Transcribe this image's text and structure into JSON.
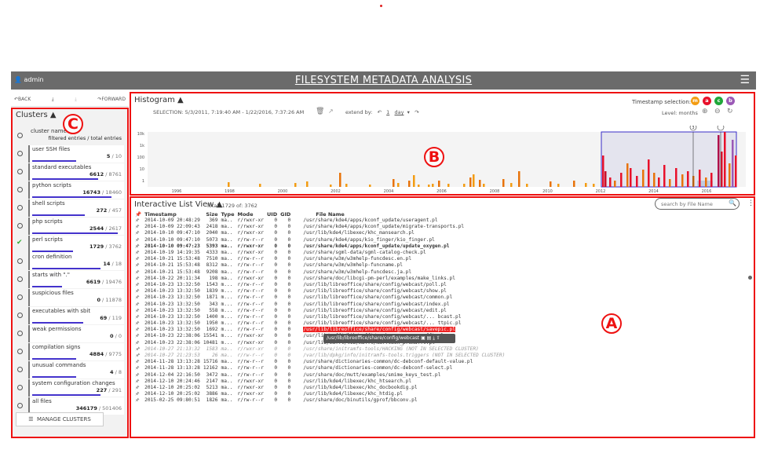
{
  "header": {
    "user": "admin",
    "title": "FILESYSTEM METADATA ANALYSIS",
    "menu_icon": "hamburger-icon"
  },
  "nav": {
    "back": "BACK",
    "forward": "FORWARD"
  },
  "labels": {
    "A": "A",
    "B": "B",
    "C": "C"
  },
  "clusters": {
    "title": "Clusters",
    "header_name": "cluster name",
    "header_sub": "filtered entries / total entries",
    "items": [
      {
        "name": "user SSH files",
        "filtered": "5",
        "total": "10",
        "pct": 0.5
      },
      {
        "name": "standard executables",
        "filtered": "6612",
        "total": "8761",
        "pct": 0.75
      },
      {
        "name": "python scripts",
        "filtered": "16743",
        "total": "18460",
        "pct": 0.9
      },
      {
        "name": "shell scripts",
        "filtered": "272",
        "total": "457",
        "pct": 0.6
      },
      {
        "name": "php scripts",
        "filtered": "2544",
        "total": "2617",
        "pct": 0.97
      },
      {
        "name": "perl scripts",
        "filtered": "1729",
        "total": "3762",
        "pct": 0.46,
        "checked": true
      },
      {
        "name": "cron definition",
        "filtered": "14",
        "total": "18",
        "pct": 0.78
      },
      {
        "name": "starts with \".\"",
        "filtered": "6619",
        "total": "19476",
        "pct": 0.34
      },
      {
        "name": "suspicious files",
        "filtered": "0",
        "total": "11878",
        "pct": 0
      },
      {
        "name": "executables with sbit",
        "filtered": "69",
        "total": "119",
        "pct": 0.58
      },
      {
        "name": "weak permissions",
        "filtered": "0",
        "total": "0",
        "pct": 0
      },
      {
        "name": "compilation signs",
        "filtered": "4884",
        "total": "9775",
        "pct": 0.5
      },
      {
        "name": "unusual commands",
        "filtered": "4",
        "total": "8",
        "pct": 0.5
      },
      {
        "name": "system configuration changes",
        "filtered": "227",
        "total": "291",
        "pct": 0.78
      },
      {
        "name": "all files",
        "filtered": "346179",
        "total": "501406",
        "pct": 0.69
      }
    ],
    "manage": "MANAGE CLUSTERS"
  },
  "histogram": {
    "title": "Histogram",
    "selection": "SELECTION: 5/3/2011, 7:19:40 AM - 1/22/2016, 7:37:26 AM",
    "extend_label": "extend by:",
    "extend_value": "1",
    "extend_unit": "day",
    "ts_label": "Timestamp selection:",
    "ts_buttons": [
      {
        "l": "m",
        "c": "#f39c12"
      },
      {
        "l": "a",
        "c": "#e8102a"
      },
      {
        "l": "c",
        "c": "#1fa83a"
      },
      {
        "l": "b",
        "c": "#9b59b6"
      }
    ],
    "level": "Level: months",
    "y_ticks": [
      "10k",
      "1k",
      "100",
      "10",
      "1"
    ],
    "x_ticks": [
      "1996",
      "1998",
      "2000",
      "2002",
      "2004",
      "2006",
      "2008",
      "2010",
      "2012",
      "2014",
      "2016"
    ],
    "markers": [
      "3",
      ""
    ]
  },
  "list": {
    "title": "Interactive List View",
    "total": "Total: 1729 of: 3762",
    "search_placeholder": "search by File Name",
    "columns": [
      "Timestamp",
      "Size",
      "Type",
      "Mode",
      "UID",
      "GID",
      "File Name"
    ],
    "tooltip": "/usr/lib/libreoffice/share/config/webcast",
    "rows": [
      [
        "2014-10-09 20:48:29",
        "369",
        "ma..",
        "r/rwxr-xr",
        "0",
        "0",
        "/usr/share/kde4/apps/kconf_update/useragent.pl",
        ""
      ],
      [
        "2014-10-09 22:09:43",
        "2418",
        "ma..",
        "r/rwxr-xr",
        "0",
        "0",
        "/usr/share/kde4/apps/kconf_update/migrate-transports.pl",
        ""
      ],
      [
        "2014-10-10 09:47:10",
        "2040",
        "ma..",
        "r/rwxr-xr",
        "0",
        "0",
        "/usr/lib/kde4/libexec/khc_mansearch.pl",
        ""
      ],
      [
        "2014-10-10 09:47:10",
        "5073",
        "ma..",
        "r/rw-r--r",
        "0",
        "0",
        "/usr/share/kde4/apps/kio_finger/kio_finger.pl",
        ""
      ],
      [
        "2014-10-10 09:47:23",
        "5393",
        "ma..",
        "r/rwxr-xr",
        "0",
        "0",
        "/usr/share/kde4/apps/kconf_update/update_oxygen.pl",
        "bold"
      ],
      [
        "2014-10-19 14:19:35",
        "4333",
        "ma..",
        "r/rwxr-xr",
        "0",
        "0",
        "/usr/share/sgml-data/sgml-catalog-check.pl",
        ""
      ],
      [
        "2014-10-21 15:53:48",
        "7510",
        "ma..",
        "r/rw-r--r",
        "0",
        "0",
        "/usr/share/w3m/w3mhelp-funcdesc.en.pl",
        ""
      ],
      [
        "2014-10-21 15:53:48",
        "8312",
        "ma..",
        "r/rw-r--r",
        "0",
        "0",
        "/usr/share/w3m/w3mhelp-funcname.pl",
        ""
      ],
      [
        "2014-10-21 15:53:48",
        "9208",
        "ma..",
        "r/rw-r--r",
        "0",
        "0",
        "/usr/share/w3m/w3mhelp-funcdesc.ja.pl",
        ""
      ],
      [
        "2014-10-22 20:11:34",
        "198",
        "ma..",
        "r/rwxr-xr",
        "0",
        "0",
        "/usr/share/doc/libcgi-pm-perl/examples/make_links.pl",
        ""
      ],
      [
        "2014-10-23 13:32:50",
        "1543",
        "m...",
        "r/rw-r--r",
        "0",
        "0",
        "/usr/lib/libreoffice/share/config/webcast/poll.pl",
        ""
      ],
      [
        "2014-10-23 13:32:50",
        "1839",
        "m...",
        "r/rw-r--r",
        "0",
        "0",
        "/usr/lib/libreoffice/share/config/webcast/show.pl",
        ""
      ],
      [
        "2014-10-23 13:32:50",
        "1871",
        "m...",
        "r/rw-r--r",
        "0",
        "0",
        "/usr/lib/libreoffice/share/config/webcast/common.pl",
        ""
      ],
      [
        "2014-10-23 13:32:50",
        "343",
        "m...",
        "r/rw-r--r",
        "0",
        "0",
        "/usr/lib/libreoffice/share/config/webcast/index.pl",
        ""
      ],
      [
        "2014-10-23 13:32:50",
        "558",
        "m...",
        "r/rw-r--r",
        "0",
        "0",
        "/usr/lib/libreoffice/share/config/webcast/edit.pl",
        ""
      ],
      [
        "2014-10-23 13:32:50",
        "1400",
        "m...",
        "r/rw-r--r",
        "0",
        "0",
        "/usr/lib/libreoffice/share/config/webcast/... bcast.pl",
        ""
      ],
      [
        "2014-10-23 13:32:50",
        "1950",
        "m...",
        "r/rw-r--r",
        "0",
        "0",
        "/usr/lib/libreoffice/share/config/webcast/... ttpic.pl",
        ""
      ],
      [
        "2014-10-23 13:32:50",
        "1692",
        "m...",
        "r/rw-r--r",
        "0",
        "0",
        "/usr/lib/libreoffice/share/config/webcast/savepic.pl",
        "hl"
      ],
      [
        "2014-10-23 22:38:06",
        "15541",
        "m...",
        "r/rwxr-xr",
        "0",
        "0",
        "/usr/lib/mafft/lib/mafft/seekquencer_premafft.pl",
        ""
      ],
      [
        "2014-10-23 22:38:06",
        "10481",
        "m...",
        "r/rwxr-xr",
        "0",
        "0",
        "/usr/lib/mafft/lib/mafft/mafftash_premafft.pl",
        ""
      ],
      [
        "2014-10-27 21:13:32",
        "1583",
        "ma..",
        "r/rwxr-xr",
        "0",
        "0",
        "/usr/share/initramfs-tools/HACKING (NOT IN SELECTED CLUSTER)",
        "gray"
      ],
      [
        "2014-10-27 21:23:53",
        "26",
        "ma..",
        "r/rw-r--r",
        "0",
        "0",
        "/var/lib/dpkg/info/initramfs-tools.triggers (NOT IN SELECTED CLUSTER)",
        "gray"
      ],
      [
        "2014-11-28 13:13:28",
        "15716",
        "ma..",
        "r/rw-r--r",
        "0",
        "0",
        "/usr/share/dictionaries-common/dc-debconf-default-value.pl",
        ""
      ],
      [
        "2014-11-28 13:13:28",
        "12162",
        "ma..",
        "r/rw-r--r",
        "0",
        "0",
        "/usr/share/dictionaries-common/dc-debconf-select.pl",
        ""
      ],
      [
        "2014-12-04 22:16:50",
        "3472",
        "ma..",
        "r/rw-r--r",
        "0",
        "0",
        "/usr/share/doc/mutt/examples/smime_keys_test.pl",
        ""
      ],
      [
        "2014-12-10 20:24:46",
        "2147",
        "ma..",
        "r/rwxr-xr",
        "0",
        "0",
        "/usr/lib/kde4/libexec/khc_htsearch.pl",
        ""
      ],
      [
        "2014-12-10 20:25:02",
        "5213",
        "ma..",
        "r/rwxr-xr",
        "0",
        "0",
        "/usr/lib/kde4/libexec/khc_docbookdig.pl",
        ""
      ],
      [
        "2014-12-10 20:25:02",
        "3886",
        "ma..",
        "r/rwxr-xr",
        "0",
        "0",
        "/usr/lib/kde4/libexec/khc_htdig.pl",
        ""
      ],
      [
        "2015-02-25 09:80:51",
        "1826",
        "ma..",
        "r/rw-r--r",
        "0",
        "0",
        "/usr/share/doc/binutils/gprof/bbconv.pl",
        ""
      ]
    ]
  }
}
